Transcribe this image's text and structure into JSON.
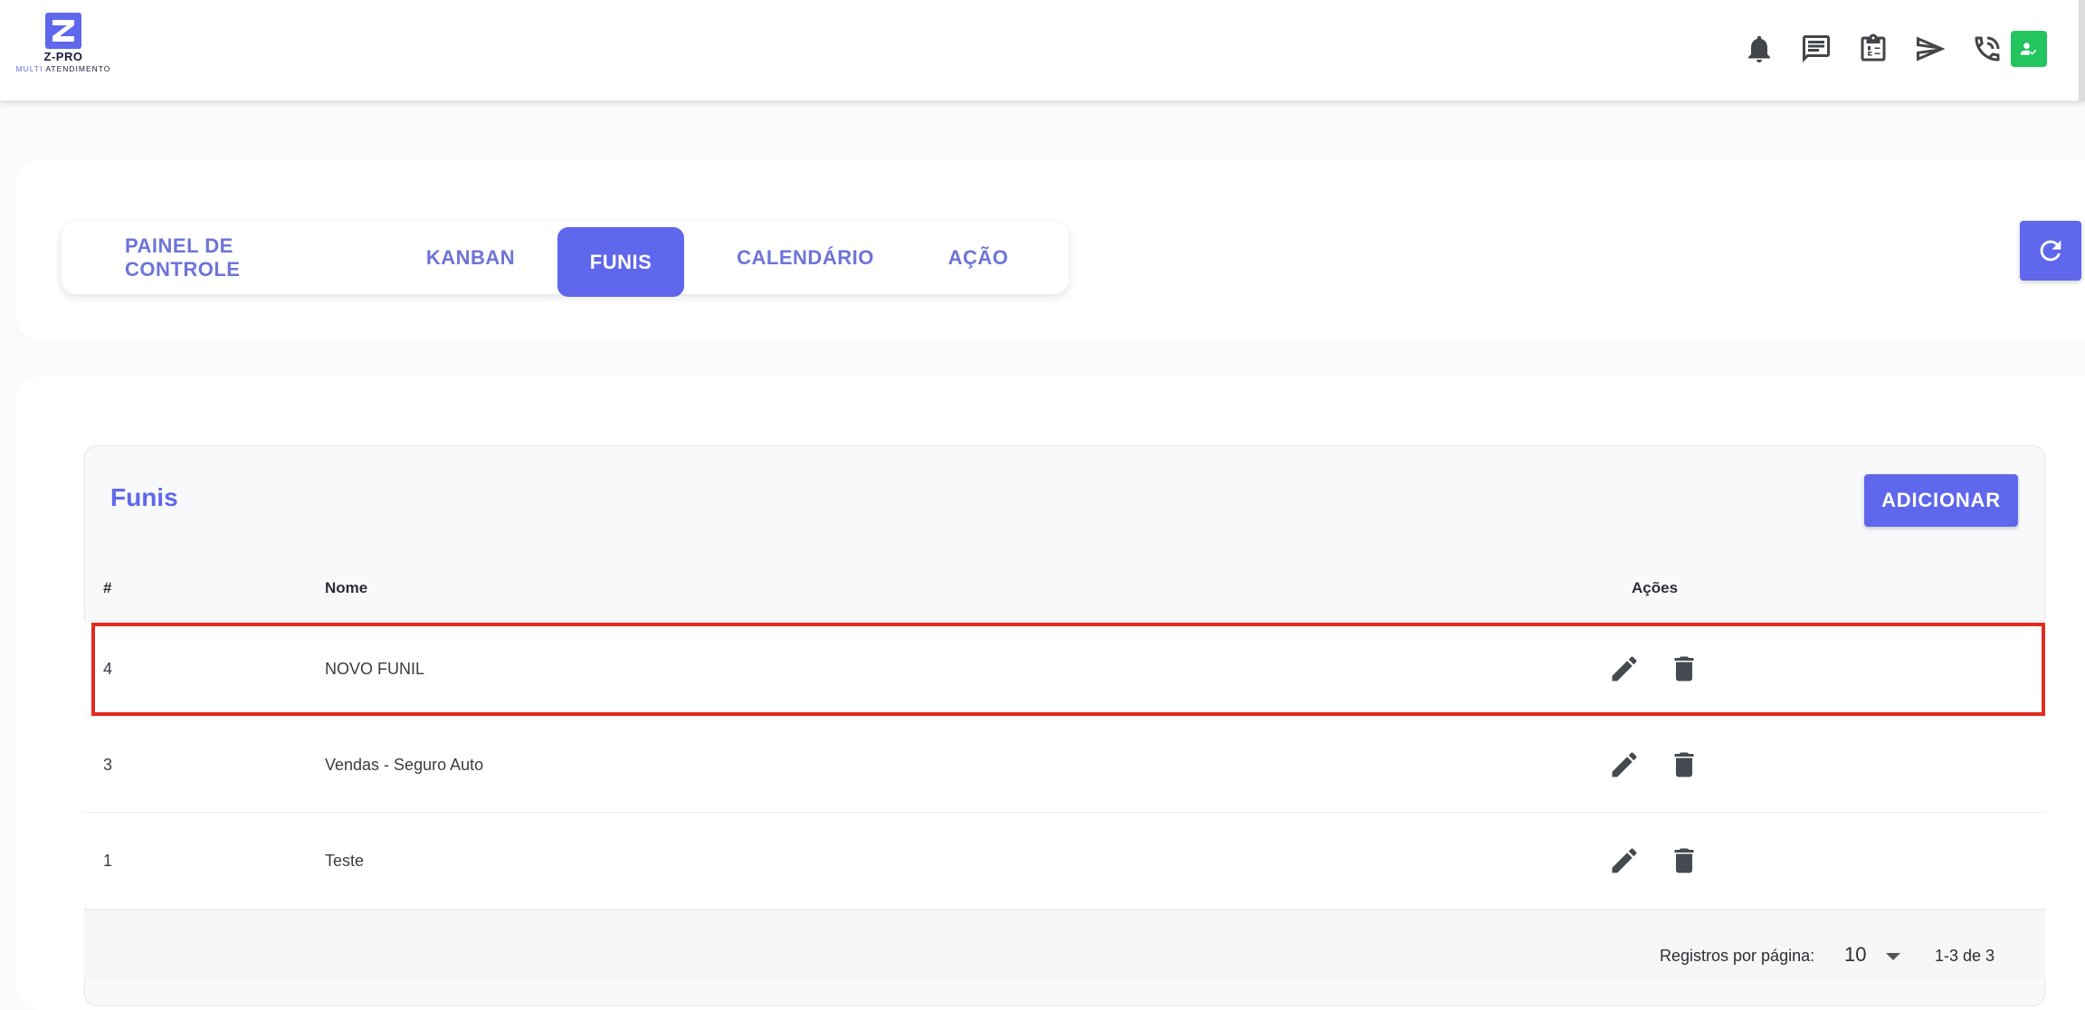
{
  "brand": {
    "name": "Z-PRO",
    "tagline_highlight": "MULTI",
    "tagline_rest": " ATENDIMENTO",
    "accent": "#5f67ec"
  },
  "header": {
    "icons": [
      "bell-icon",
      "chat-icon",
      "clipboard-icon",
      "send-icon",
      "phone-icon"
    ],
    "avatar_status_color": "#22c55e"
  },
  "tabs": [
    {
      "label": "PAINEL DE CONTROLE",
      "active": false
    },
    {
      "label": "KANBAN",
      "active": false
    },
    {
      "label": "FUNIS",
      "active": true
    },
    {
      "label": "CALENDÁRIO",
      "active": false
    },
    {
      "label": "AÇÃO",
      "active": false
    }
  ],
  "panel": {
    "title": "Funis",
    "add_label": "ADICIONAR",
    "columns": {
      "id": "#",
      "name": "Nome",
      "actions": "Ações"
    },
    "rows": [
      {
        "id": "4",
        "name": "NOVO FUNIL",
        "selected": true
      },
      {
        "id": "3",
        "name": "Vendas - Seguro Auto",
        "selected": false
      },
      {
        "id": "1",
        "name": "Teste",
        "selected": false
      }
    ],
    "highlight_color": "#e32b21"
  },
  "pagination": {
    "label": "Registros por página:",
    "per_page": "10",
    "range": "1-3 de 3"
  }
}
